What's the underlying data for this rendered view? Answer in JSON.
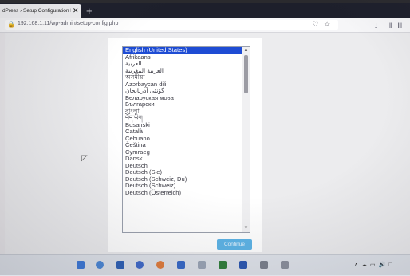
{
  "browser": {
    "tab_title": "dPress › Setup Configuration Fi",
    "tab_close": "✕",
    "new_tab": "+",
    "url": "192.168.1.11/wp-admin/setup-config.php",
    "page_actions": "… ♡ ☆",
    "toolbar_icons": "⭳ ⅡⅢ ≡"
  },
  "language_list": {
    "selected_index": 0,
    "items": [
      "English (United States)",
      "Afrikaans",
      "العربية",
      "العربية المغربية",
      "অসমীয়া",
      "Azərbaycan dili",
      "گؤنئی آذربایجان",
      "Беларуская мова",
      "Български",
      "বাংলা",
      "བོད་ཡིག",
      "Bosanski",
      "Català",
      "Cebuano",
      "Čeština",
      "Cymraeg",
      "Dansk",
      "Deutsch",
      "Deutsch (Sie)",
      "Deutsch (Schweiz, Du)",
      "Deutsch (Schweiz)",
      "Deutsch (Österreich)"
    ]
  },
  "continue_label": "Continue",
  "taskbar": {
    "tray_text": "∧ ☁ ▭ 🔊 □"
  },
  "colors": {
    "selected": "#1e4cd4",
    "continue": "#5cb3e6"
  }
}
